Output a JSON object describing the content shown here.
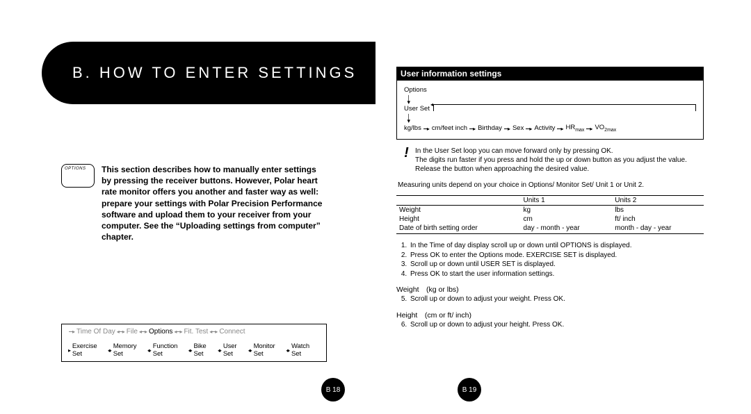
{
  "left": {
    "band_title": "B. HOW TO ENTER SETTINGS",
    "device_label": "OPTIONS",
    "intro": "This section describes how to manually enter settings by pressing the receiver buttons. However, Polar heart rate monitor offers you another and faster way as well: prepare your settings with Polar Precision Performance software and upload them to your receiver from your computer. See the “Uploading settings from computer” chapter.",
    "flow_top": [
      "Time Of Day",
      "File",
      "Options",
      "Fit. Test",
      "Connect"
    ],
    "flow_top_highlight_index": 2,
    "flow_bottom": [
      "Exercise Set",
      "Memory Set",
      "Function Set",
      "Bike Set",
      "User Set",
      "Monitor Set",
      "Watch Set"
    ],
    "page_num": "B 18"
  },
  "right": {
    "section_title": "User information settings",
    "uf_top_a": "Options",
    "uf_top_b": "User Set",
    "uf_items": [
      "kg/lbs",
      "cm/feet inch",
      "Birthday",
      "Sex",
      "Activity"
    ],
    "uf_hr_label": "HR",
    "uf_hr_sub": "max",
    "uf_vo_label": "VO",
    "uf_vo_sub": "2max",
    "note_line1": "In the User Set loop you can move forward only by pressing OK.",
    "note_line2": "The digits run faster if you press and hold the up or down button as you adjust the value. Release the button when approaching the desired value.",
    "measuring": "Measuring units depend on your choice in Options/ Monitor Set/ Unit 1 or Unit 2.",
    "table": {
      "head": [
        "",
        "Units 1",
        "Units 2"
      ],
      "rows": [
        [
          "Weight",
          "kg",
          "lbs"
        ],
        [
          "Height",
          "cm",
          "ft/ inch"
        ],
        [
          "Date of birth setting order",
          "day - month - year",
          "month - day - year"
        ]
      ]
    },
    "steps": [
      "In the Time of day display scroll up or down until OPTIONS is displayed.",
      "Press OK to enter the Options mode. EXERCISE SET is displayed.",
      "Scroll up or down until USER SET is displayed.",
      "Press OK to start the user information settings."
    ],
    "weight_head": "Weight (kg or lbs)",
    "step5": "Scroll up or down to adjust your weight. Press OK.",
    "height_head": "Height (cm or ft/ inch)",
    "step6": "Scroll up or down to adjust your height. Press OK.",
    "page_num": "B 19"
  }
}
